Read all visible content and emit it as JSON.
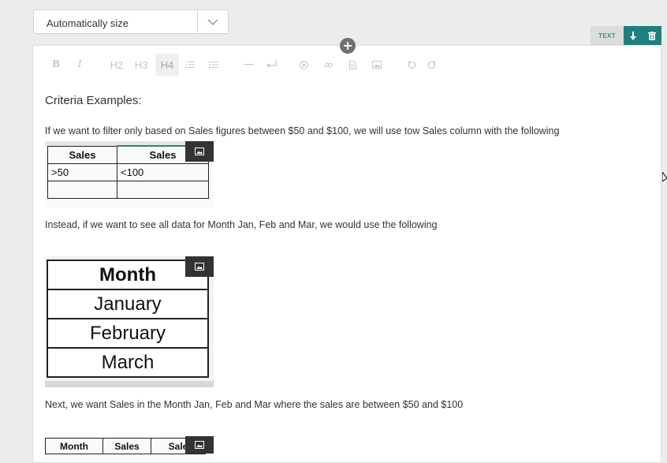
{
  "size_dropdown": {
    "selected": "Automatically size"
  },
  "block_controls": {
    "type_label": "TEXT",
    "move_icon": "arrow-down-icon",
    "delete_icon": "trash-icon"
  },
  "add_block_icon": "plus-circle-icon",
  "toolbar": {
    "bold": "B",
    "italic": "I",
    "h2": "H2",
    "h3": "H3",
    "h4": "H4",
    "ordered_list_icon": "ordered-list-icon",
    "unordered_list_icon": "unordered-list-icon",
    "horizontal_rule_icon": "horizontal-rule-icon",
    "line_break_icon": "line-break-icon",
    "video_icon": "video-icon",
    "link_icon": "link-icon",
    "file_icon": "file-icon",
    "image_icon": "image-icon",
    "undo_icon": "undo-icon",
    "redo_icon": "redo-icon"
  },
  "content": {
    "heading": "Criteria Examples:",
    "para1": "If we want to filter only based on Sales figures between $50 and $100, we will use tow Sales column with the following",
    "image1": {
      "headers": [
        "Sales",
        "Sales"
      ],
      "row1": [
        ">50",
        "<100"
      ]
    },
    "para2": "Instead, if we want to see all data for Month Jan, Feb and Mar, we would use the following",
    "image2": {
      "header": "Month",
      "rows": [
        "January",
        "February",
        "March"
      ]
    },
    "para3": "Next, we want Sales in the Month Jan, Feb and Mar where the sales are between $50 and $100",
    "image3": {
      "headers": [
        "Month",
        "Sales",
        "Sale"
      ]
    }
  },
  "colors": {
    "accent": "#1f7f7f",
    "badge": "#333333",
    "text_tag": "#3a8b8a"
  }
}
